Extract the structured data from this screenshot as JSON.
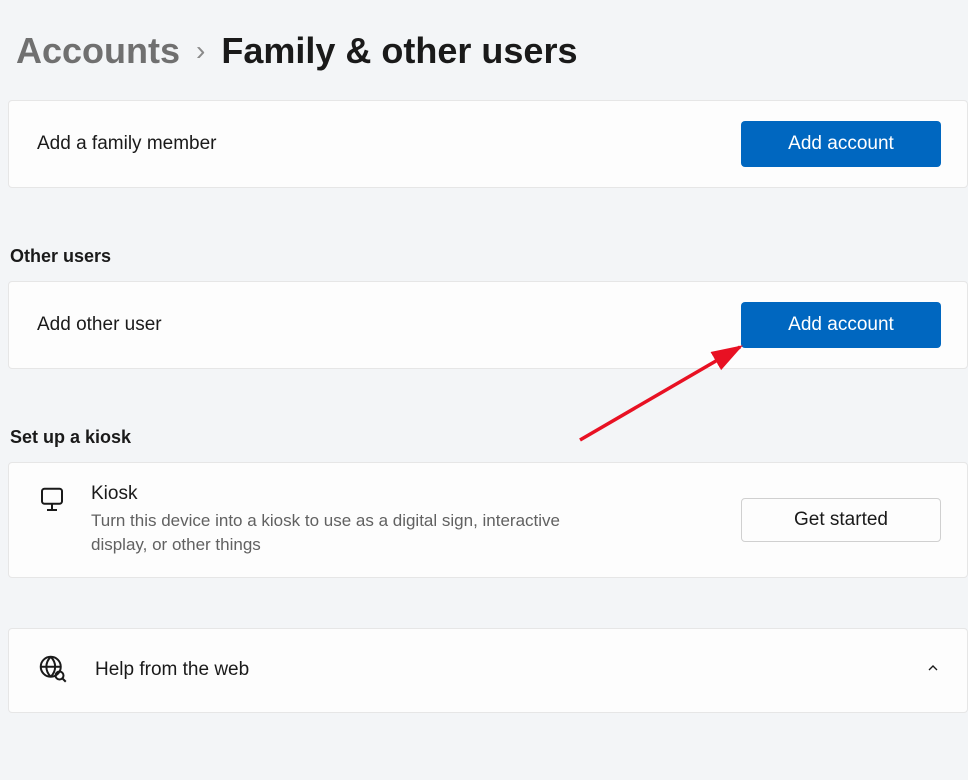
{
  "breadcrumb": {
    "parent": "Accounts",
    "current": "Family & other users"
  },
  "family": {
    "add_label": "Add a family member",
    "add_button": "Add account"
  },
  "other_users": {
    "section_title": "Other users",
    "add_label": "Add other user",
    "add_button": "Add account"
  },
  "kiosk": {
    "section_title": "Set up a kiosk",
    "title": "Kiosk",
    "description": "Turn this device into a kiosk to use as a digital sign, interactive display, or other things",
    "button": "Get started"
  },
  "help": {
    "title": "Help from the web"
  }
}
